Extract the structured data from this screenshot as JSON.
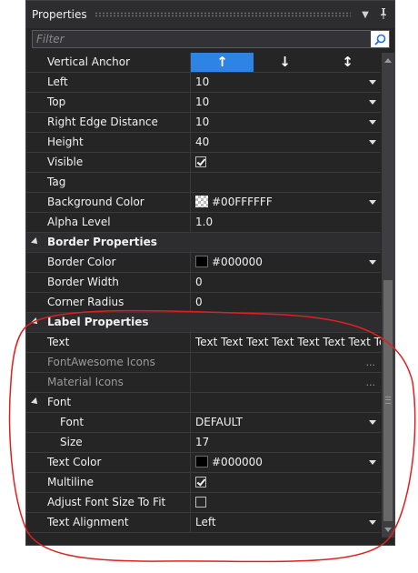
{
  "panel": {
    "title": "Properties",
    "search_placeholder": "Filter"
  },
  "vertical_anchor": {
    "label": "Vertical Anchor",
    "options": [
      "↑",
      "↓",
      "↕"
    ],
    "selected": 0
  },
  "rows_top": [
    {
      "name": "Left",
      "value": "10",
      "dropdown": true
    },
    {
      "name": "Top",
      "value": "10",
      "dropdown": true
    },
    {
      "name": "Right Edge Distance",
      "value": "10",
      "dropdown": true
    },
    {
      "name": "Height",
      "value": "40",
      "dropdown": true
    },
    {
      "name": "Visible",
      "checkbox": true,
      "checked": true
    },
    {
      "name": "Tag",
      "value": ""
    },
    {
      "name": "Background Color",
      "value": "#00FFFFFF",
      "swatch": "transparent",
      "dropdown": true
    },
    {
      "name": "Alpha Level",
      "value": "1.0"
    }
  ],
  "border_category": {
    "label": "Border Properties",
    "rows": [
      {
        "name": "Border Color",
        "value": "#000000",
        "swatch": "black",
        "dropdown": true
      },
      {
        "name": "Border Width",
        "value": "0"
      },
      {
        "name": "Corner Radius",
        "value": "0"
      }
    ]
  },
  "label_category": {
    "label": "Label Properties",
    "rows": [
      {
        "name": "Text",
        "value": "Text Text Text Text Text Text Text Text Text"
      },
      {
        "name": "FontAwesome Icons",
        "value": "",
        "ellipsis": "...",
        "disabled": true
      },
      {
        "name": "Material Icons",
        "value": "",
        "ellipsis": "...",
        "disabled": true
      }
    ]
  },
  "font_group": {
    "label": "Font",
    "rows": [
      {
        "name": "Font",
        "value": "DEFAULT",
        "dropdown": true
      },
      {
        "name": "Size",
        "value": "17"
      }
    ]
  },
  "rows_bottom": [
    {
      "name": "Text Color",
      "value": "#000000",
      "swatch": "black",
      "dropdown": true
    },
    {
      "name": "Multiline",
      "checkbox": true,
      "checked": true
    },
    {
      "name": "Adjust Font Size To Fit",
      "checkbox": true,
      "checked": false
    },
    {
      "name": "Text Alignment",
      "value": "Left",
      "dropdown": true
    }
  ],
  "colors": {
    "panel_bg": "#252526",
    "category_bg": "#2d2d30",
    "accent": "#2d84e5",
    "annotation": "#e02020"
  }
}
